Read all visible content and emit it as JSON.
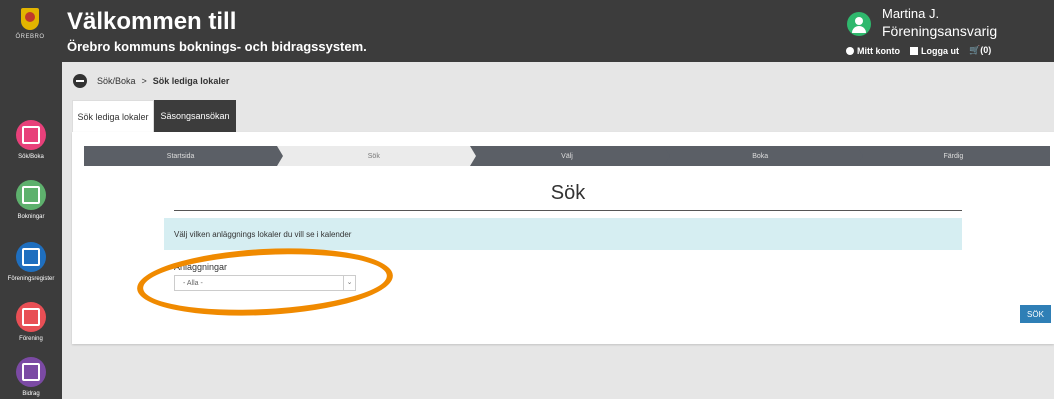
{
  "header": {
    "logo_text": "ÖREBRO",
    "title": "Välkommen till",
    "subtitle": "Örebro kommuns boknings- och bidragssystem.",
    "user_name": "Martina J.",
    "user_role": "Föreningsansvarig",
    "links": {
      "my_account": "Mitt konto",
      "logout": "Logga ut",
      "cart": "(0)"
    }
  },
  "sidebar": {
    "items": [
      {
        "label": "Sök/Boka",
        "icon": "calendar-icon",
        "color": "#e8407a"
      },
      {
        "label": "Bokningar",
        "icon": "calendar-check-icon",
        "color": "#5eb16d"
      },
      {
        "label": "Föreningsregister",
        "icon": "list-icon",
        "color": "#1f6fbf"
      },
      {
        "label": "Förening",
        "icon": "group-icon",
        "color": "#e84f55"
      },
      {
        "label": "Bidrag",
        "icon": "calculator-icon",
        "color": "#7b4aa4"
      }
    ]
  },
  "breadcrumb": {
    "parent": "Sök/Boka",
    "separator": ">",
    "current": "Sök lediga lokaler"
  },
  "tabs": {
    "active": "Sök lediga lokaler",
    "inactive": "Säsongsansökan"
  },
  "steps": [
    "Startsida",
    "Sök",
    "Välj",
    "Boka",
    "Färdig"
  ],
  "main": {
    "title": "Sök",
    "info": "Välj vilken anläggnings lokaler du vill se i kalender",
    "field_label": "Anläggningar",
    "select_value": "- Alla -",
    "search_button": "SÖK"
  }
}
